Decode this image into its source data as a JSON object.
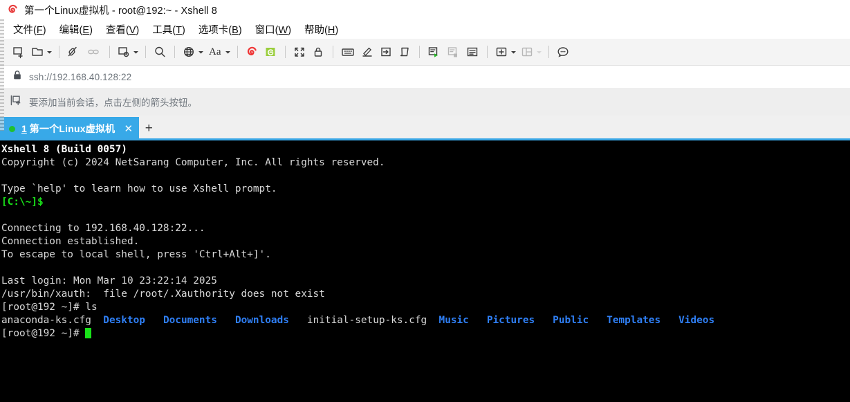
{
  "window": {
    "title": "第一个Linux虚拟机 - root@192:~ - Xshell 8",
    "logo_icon": "xshell-spiral-logo"
  },
  "menubar": {
    "items": [
      {
        "label": "文件(F)",
        "text": "文件(",
        "accel": "F",
        "tail": ")"
      },
      {
        "label": "编辑(E)",
        "text": "编辑(",
        "accel": "E",
        "tail": ")"
      },
      {
        "label": "查看(V)",
        "text": "查看(",
        "accel": "V",
        "tail": ")"
      },
      {
        "label": "工具(T)",
        "text": "工具(",
        "accel": "T",
        "tail": ")"
      },
      {
        "label": "选项卡(B)",
        "text": "选项卡(",
        "accel": "B",
        "tail": ")"
      },
      {
        "label": "窗口(W)",
        "text": "窗口(",
        "accel": "W",
        "tail": ")"
      },
      {
        "label": "帮助(H)",
        "text": "帮助(",
        "accel": "H",
        "tail": ")"
      }
    ]
  },
  "toolbar": {
    "items": [
      {
        "icon": "new-session-icon",
        "name": "new-session-button"
      },
      {
        "icon": "open-session-folder-icon",
        "name": "open-session-button",
        "caret": true
      },
      {
        "icon": "disconnect-icon",
        "name": "disconnect-button"
      },
      {
        "icon": "reconnect-link-icon",
        "name": "reconnect-button",
        "disabled": true
      },
      {
        "icon": "session-properties-icon",
        "name": "properties-button",
        "caret": true
      },
      {
        "icon": "search-icon",
        "name": "find-button"
      },
      {
        "icon": "globe-icon",
        "name": "encoding-button",
        "caret": true
      },
      {
        "icon": "font-size-icon",
        "name": "font-button",
        "caret": true,
        "label": "Aa"
      },
      {
        "icon": "xftp-spiral-icon",
        "name": "xftp-button"
      },
      {
        "icon": "xftp-green-icon",
        "name": "new-file-transfer-button"
      },
      {
        "icon": "fullscreen-icon",
        "name": "fullscreen-button"
      },
      {
        "icon": "lock-icon",
        "name": "lock-session-button"
      },
      {
        "icon": "keyboard-icon",
        "name": "compose-bar-button"
      },
      {
        "icon": "highlight-pen-icon",
        "name": "highlight-button"
      },
      {
        "icon": "send-key-icon",
        "name": "send-key-button"
      },
      {
        "icon": "script-icon",
        "name": "script-button"
      },
      {
        "icon": "run-script-icon",
        "name": "run-script-button"
      },
      {
        "icon": "stop-script-icon",
        "name": "stop-script-button",
        "disabled": true
      },
      {
        "icon": "log-icon",
        "name": "session-log-button"
      },
      {
        "icon": "add-pane-icon",
        "name": "add-pane-button",
        "caret": true
      },
      {
        "icon": "split-layout-icon",
        "name": "layout-button",
        "caret": true,
        "disabled": true
      },
      {
        "icon": "chat-icon",
        "name": "chat-button"
      }
    ]
  },
  "address_bar": {
    "lock_icon": "lock-icon",
    "url": "ssh://192.168.40.128:22"
  },
  "hint_bar": {
    "icon": "add-session-icon",
    "text": "要添加当前会话，点击左侧的箭头按钮。"
  },
  "tabbar": {
    "tab": {
      "status_icon": "connected-dot",
      "index": "1",
      "title": "第一个Linux虚拟机",
      "close_icon": "✕"
    },
    "new_tab_icon": "+"
  },
  "terminal": {
    "lines": [
      {
        "segments": [
          {
            "text": "Xshell 8 (Build 0057)",
            "style": "bold"
          }
        ]
      },
      {
        "segments": [
          {
            "text": "Copyright (c) 2024 NetSarang Computer, Inc. All rights reserved.",
            "style": "normal"
          }
        ]
      },
      {
        "segments": [
          {
            "text": "",
            "style": "normal"
          }
        ]
      },
      {
        "segments": [
          {
            "text": "Type `help' to learn how to use Xshell prompt.",
            "style": "normal"
          }
        ]
      },
      {
        "segments": [
          {
            "text": "[C:\\~]$",
            "style": "green"
          }
        ]
      },
      {
        "segments": [
          {
            "text": "",
            "style": "normal"
          }
        ]
      },
      {
        "segments": [
          {
            "text": "Connecting to 192.168.40.128:22...",
            "style": "normal"
          }
        ]
      },
      {
        "segments": [
          {
            "text": "Connection established.",
            "style": "normal"
          }
        ]
      },
      {
        "segments": [
          {
            "text": "To escape to local shell, press 'Ctrl+Alt+]'.",
            "style": "normal"
          }
        ]
      },
      {
        "segments": [
          {
            "text": "",
            "style": "normal"
          }
        ]
      },
      {
        "segments": [
          {
            "text": "Last login: Mon Mar 10 23:22:14 2025",
            "style": "normal"
          }
        ]
      },
      {
        "segments": [
          {
            "text": "/usr/bin/xauth:  file /root/.Xauthority does not exist",
            "style": "normal"
          }
        ]
      },
      {
        "segments": [
          {
            "text": "[root@192 ~]# ls",
            "style": "normal"
          }
        ]
      },
      {
        "segments": [
          {
            "text": "anaconda-ks.cfg  ",
            "style": "normal"
          },
          {
            "text": "Desktop",
            "style": "dir"
          },
          {
            "text": "   ",
            "style": "normal"
          },
          {
            "text": "Documents",
            "style": "dir"
          },
          {
            "text": "   ",
            "style": "normal"
          },
          {
            "text": "Downloads",
            "style": "dir"
          },
          {
            "text": "   initial-setup-ks.cfg  ",
            "style": "normal"
          },
          {
            "text": "Music",
            "style": "dir"
          },
          {
            "text": "   ",
            "style": "normal"
          },
          {
            "text": "Pictures",
            "style": "dir"
          },
          {
            "text": "   ",
            "style": "normal"
          },
          {
            "text": "Public",
            "style": "dir"
          },
          {
            "text": "   ",
            "style": "normal"
          },
          {
            "text": "Templates",
            "style": "dir"
          },
          {
            "text": "   ",
            "style": "normal"
          },
          {
            "text": "Videos",
            "style": "dir"
          }
        ]
      },
      {
        "segments": [
          {
            "text": "[root@192 ~]# ",
            "style": "normal"
          },
          {
            "text": "",
            "style": "cursor"
          }
        ]
      }
    ],
    "colors": {
      "background": "#000000",
      "foreground": "#d8d8d8",
      "directory": "#2f7ff5",
      "prompt_green": "#19e219",
      "cursor": "#19e219"
    }
  }
}
